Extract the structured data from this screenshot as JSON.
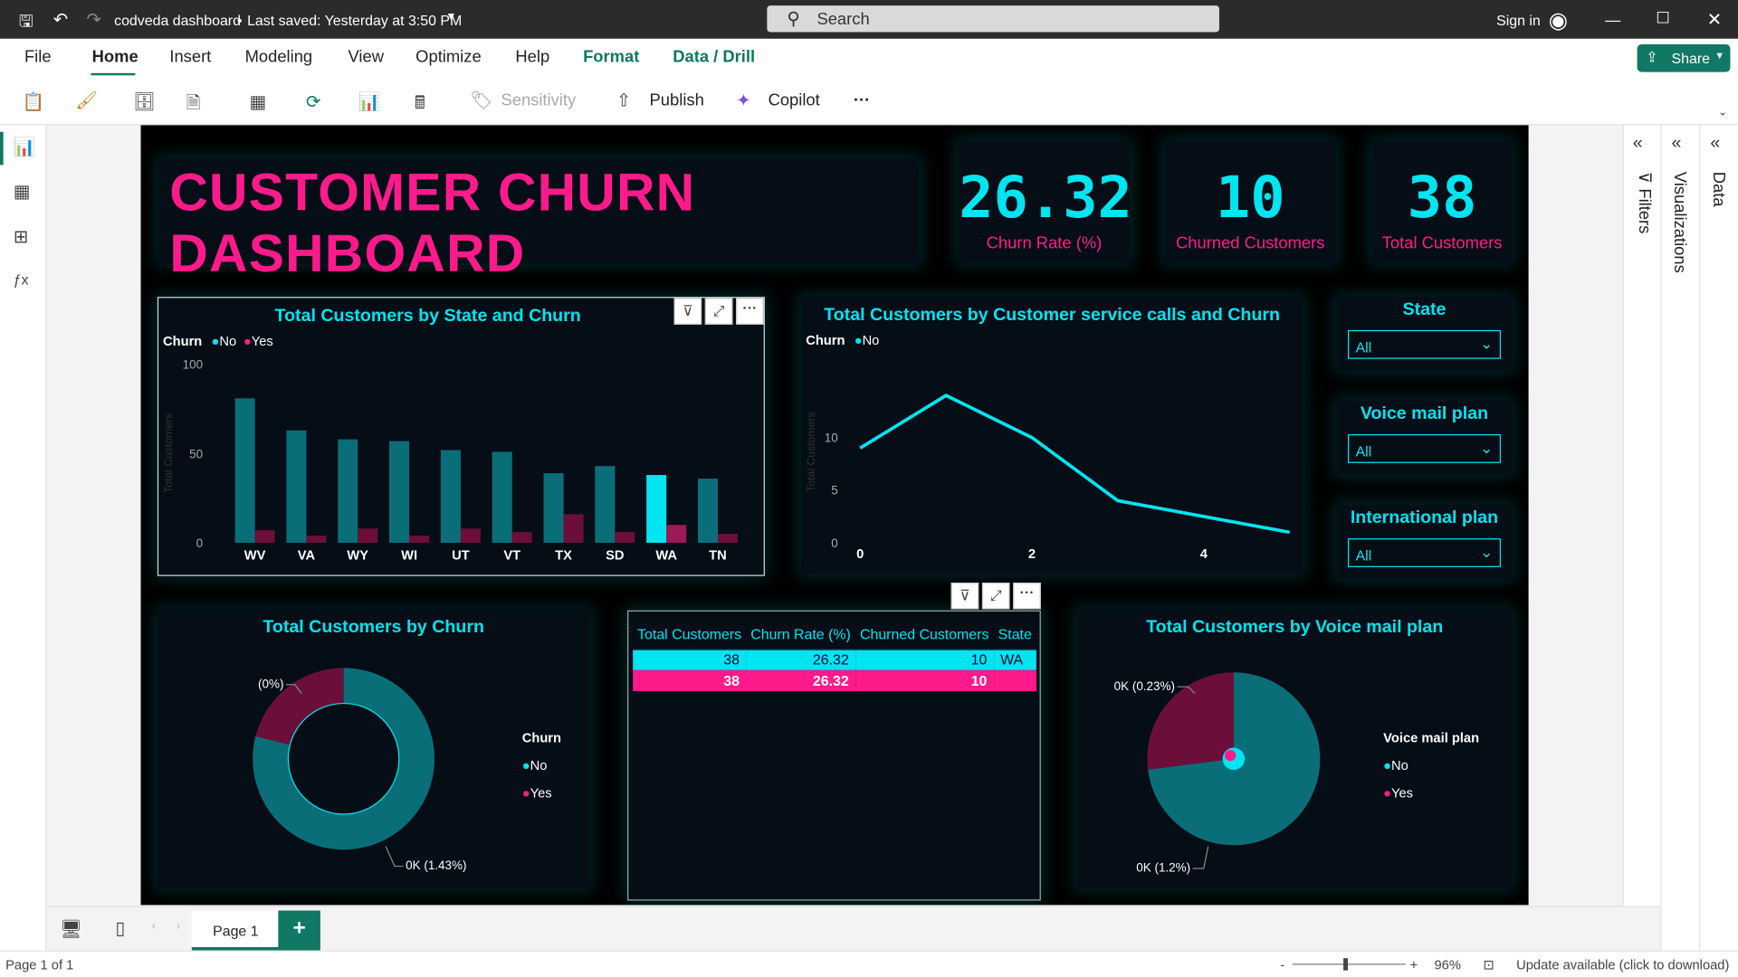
{
  "titlebar": {
    "file_name": "codveda dashboard",
    "save_status": "Last saved: Yesterday at 3:50 PM",
    "search_placeholder": "Search",
    "sign_in": "Sign in"
  },
  "menu": {
    "items": [
      "File",
      "Home",
      "Insert",
      "Modeling",
      "View",
      "Optimize",
      "Help",
      "Format",
      "Data / Drill"
    ],
    "share": "Share"
  },
  "ribbon": {
    "sensitivity": "Sensitivity",
    "publish": "Publish",
    "copilot": "Copilot",
    "more": "···"
  },
  "dashboard": {
    "title": "CUSTOMER CHURN DASHBOARD",
    "kpis": [
      {
        "value": "26.32",
        "label": "Churn Rate (%)"
      },
      {
        "value": "10",
        "label": "Churned Customers"
      },
      {
        "value": "38",
        "label": "Total Customers"
      }
    ],
    "slicers": [
      {
        "title": "State",
        "value": "All"
      },
      {
        "title": "Voice mail plan",
        "value": "All"
      },
      {
        "title": "International plan",
        "value": "All"
      }
    ],
    "table": {
      "columns": [
        "Total Customers",
        "Churn Rate (%)",
        "Churned Customers",
        "State"
      ],
      "rows": [
        [
          "38",
          "26.32",
          "10",
          "WA"
        ],
        [
          "38",
          "26.32",
          "10",
          ""
        ]
      ]
    }
  },
  "chart_data": [
    {
      "type": "bar",
      "title": "Total Customers by State and Churn",
      "legend_title": "Churn",
      "categories": [
        "WV",
        "VA",
        "WY",
        "WI",
        "UT",
        "VT",
        "TX",
        "SD",
        "WA",
        "TN"
      ],
      "series": [
        {
          "name": "No",
          "values": [
            81,
            63,
            58,
            57,
            52,
            51,
            39,
            43,
            38,
            36
          ]
        },
        {
          "name": "Yes",
          "values": [
            7,
            4,
            8,
            4,
            8,
            6,
            16,
            6,
            10,
            5
          ]
        }
      ],
      "ylabel": "Total Customers",
      "ylim": [
        0,
        100
      ],
      "yticks": [
        "0",
        "50",
        "100"
      ],
      "highlight": "WA"
    },
    {
      "type": "line",
      "title": "Total Customers by Customer service calls and Churn",
      "legend_title": "Churn",
      "series": [
        {
          "name": "No",
          "x": [
            0,
            1,
            2,
            3,
            4,
            5
          ],
          "values": [
            9,
            14,
            10,
            4,
            2.5,
            1
          ]
        }
      ],
      "xticks": [
        "0",
        "2",
        "4"
      ],
      "yticks": [
        "0",
        "5",
        "10"
      ],
      "ylabel": "Total Customers",
      "ylim": [
        0,
        16
      ]
    },
    {
      "type": "pie",
      "title": "Total Customers by Churn",
      "legend_title": "Churn",
      "donut": true,
      "slices": [
        {
          "name": "No",
          "value": 79
        },
        {
          "name": "Yes",
          "value": 21
        }
      ],
      "labels": [
        "(0%)",
        "0K (1.43%)"
      ]
    },
    {
      "type": "pie",
      "title": "Total Customers by Voice mail plan",
      "legend_title": "Voice mail plan",
      "slices": [
        {
          "name": "No",
          "value": 73
        },
        {
          "name": "Yes",
          "value": 27
        }
      ],
      "labels": [
        "0K (0.23%)",
        "0K (1.2%)"
      ]
    }
  ],
  "colors": {
    "teal": "#0a6e78",
    "cyan": "#00e5f0",
    "pink": "#ff1a8c",
    "maroon": "#6b0f3a",
    "green": "#117865"
  },
  "pages": {
    "tab": "Page 1",
    "add": "+"
  },
  "status": {
    "page": "Page 1 of 1",
    "zoom": "96%",
    "update": "Update available (click to download)"
  }
}
